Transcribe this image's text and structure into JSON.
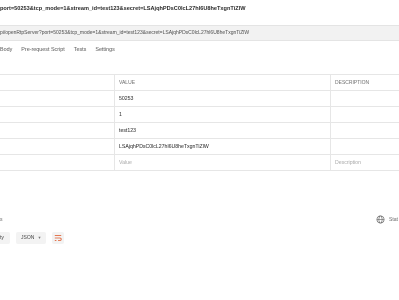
{
  "request": {
    "title": "port=50253&tcp_mode=1&stream_id=test123&secret=LSAjqhPDsC0lcL27hl6U8heTxgnTiZlW",
    "url": "pi/openRtpServer?port=50253&tcp_mode=1&stream_id=test123&secret=LSAjqhPDsC0lcL27hl6U8heTxgnTiZlW"
  },
  "tabs": [
    "Body",
    "Pre-request Script",
    "Tests",
    "Settings"
  ],
  "params_table": {
    "headers": {
      "value": "VALUE",
      "description": "DESCRIPTION"
    },
    "rows": [
      {
        "value": "50253",
        "description": ""
      },
      {
        "value": "1",
        "description": ""
      },
      {
        "value": "test123",
        "description": ""
      },
      {
        "value": "LSAjqhPDsC0lcL27hl6U8heTxgnTiZlW",
        "description": ""
      }
    ],
    "new_row": {
      "value_placeholder": "Value",
      "description_placeholder": "Description"
    }
  },
  "status_bar": {
    "left_text": "s",
    "right_text": "Stat",
    "globe_icon": "globe-icon"
  },
  "response": {
    "view_select": "ty",
    "format_select": "JSON",
    "wrap_icon": "wrap-lines-icon",
    "wrap_icon_color": "#e05a2b"
  }
}
